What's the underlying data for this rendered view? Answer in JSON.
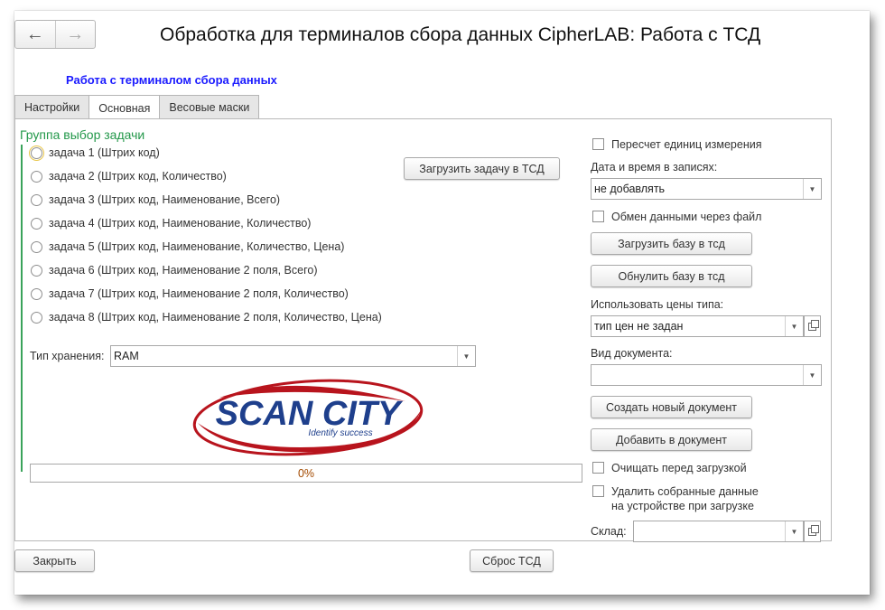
{
  "window": {
    "title": "Обработка для терминалов сбора данных CipherLAB: Работа с ТСД",
    "subtitle": "Работа с терминалом сбора данных",
    "nav": {
      "back_icon": "←",
      "forward_icon": "→"
    }
  },
  "tabs": [
    {
      "label": "Настройки",
      "active": false
    },
    {
      "label": "Основная",
      "active": true
    },
    {
      "label": "Весовые маски",
      "active": false
    }
  ],
  "left": {
    "group_title": "Группа выбор задачи",
    "tasks": [
      "задача 1 (Штрих код)",
      "задача 2 (Штрих код, Количество)",
      "задача 3 (Штрих код, Наименование, Всего)",
      "задача 4 (Штрих код, Наименование, Количество)",
      "задача 5 (Штрих код, Наименование, Количество, Цена)",
      "задача 6 (Штрих код, Наименование 2 поля, Всего)",
      "задача 7 (Штрих код, Наименование 2 поля, Количество)",
      "задача 8 (Штрих код, Наименование 2 поля, Количество, Цена)"
    ],
    "load_task_button": "Загрузить задачу в ТСД",
    "storage_label": "Тип хранения:",
    "storage_value": "RAM",
    "logo": {
      "text": "SCAN CITY",
      "tagline": "Identify success",
      "color_text": "#1e3f8c",
      "color_swoosh": "#b8141d"
    },
    "progress_text": "0%",
    "progress_value": 0
  },
  "right": {
    "recalc_units_label": "Пересчет единиц измерения",
    "datetime_label": "Дата и время в записях:",
    "datetime_value": "не добавлять",
    "file_exchange_label": "Обмен данными через файл",
    "load_base_button": "Загрузить базу в тсд",
    "reset_base_button": "Обнулить базу в тсд",
    "price_type_label": "Использовать цены типа:",
    "price_type_value": "тип цен не задан",
    "doc_type_label": "Вид документа:",
    "doc_type_value": "",
    "create_doc_button": "Создать новый документ",
    "add_doc_button": "Добавить в документ",
    "clear_before_label": "Очищать перед загрузкой",
    "delete_data_label_1": "Удалить собранные данные",
    "delete_data_label_2": "на устройстве при загрузке",
    "warehouse_label": "Склад:",
    "warehouse_value": ""
  },
  "footer": {
    "close_button": "Закрыть",
    "reset_tsd_button": "Сброс ТСД"
  }
}
